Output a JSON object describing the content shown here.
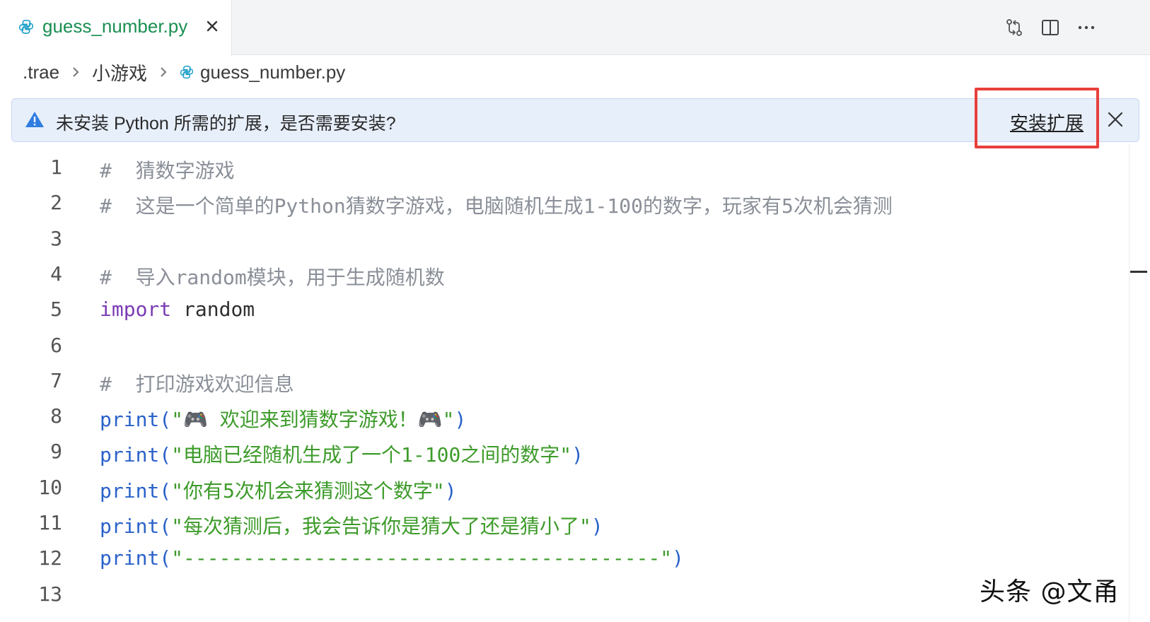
{
  "tab": {
    "title": "guess_number.py"
  },
  "breadcrumb": {
    "items": [
      ".trae",
      "小游戏",
      "guess_number.py"
    ]
  },
  "notification": {
    "message": "未安装 Python 所需的扩展，是否需要安装?",
    "action_label": "安装扩展"
  },
  "editor": {
    "lines": [
      {
        "num": "1",
        "parts": [
          {
            "t": "#  猜数字游戏",
            "k": "comment"
          }
        ]
      },
      {
        "num": "2",
        "parts": [
          {
            "t": "#  这是一个简单的Python猜数字游戏，电脑随机生成1-100的数字，玩家有5次机会猜测",
            "k": "comment"
          }
        ]
      },
      {
        "num": "3",
        "parts": []
      },
      {
        "num": "4",
        "parts": [
          {
            "t": "#  导入random模块，用于生成随机数",
            "k": "comment"
          }
        ]
      },
      {
        "num": "5",
        "parts": [
          {
            "t": "import",
            "k": "kw"
          },
          {
            "t": " random",
            "k": "plain"
          }
        ]
      },
      {
        "num": "6",
        "parts": []
      },
      {
        "num": "7",
        "parts": [
          {
            "t": "#  打印游戏欢迎信息",
            "k": "comment"
          }
        ]
      },
      {
        "num": "8",
        "parts": [
          {
            "t": "print(",
            "k": "fn"
          },
          {
            "t": "\"🎮 欢迎来到猜数字游戏！🎮\"",
            "k": "str"
          },
          {
            "t": ")",
            "k": "fn"
          }
        ]
      },
      {
        "num": "9",
        "parts": [
          {
            "t": "print(",
            "k": "fn"
          },
          {
            "t": "\"电脑已经随机生成了一个1-100之间的数字\"",
            "k": "str"
          },
          {
            "t": ")",
            "k": "fn"
          }
        ]
      },
      {
        "num": "10",
        "parts": [
          {
            "t": "print(",
            "k": "fn"
          },
          {
            "t": "\"你有5次机会来猜测这个数字\"",
            "k": "str"
          },
          {
            "t": ")",
            "k": "fn"
          }
        ]
      },
      {
        "num": "11",
        "parts": [
          {
            "t": "print(",
            "k": "fn"
          },
          {
            "t": "\"每次猜测后，我会告诉你是猜大了还是猜小了\"",
            "k": "str"
          },
          {
            "t": ")",
            "k": "fn"
          }
        ]
      },
      {
        "num": "12",
        "parts": [
          {
            "t": "print(",
            "k": "fn"
          },
          {
            "t": "\"----------------------------------------\"",
            "k": "str"
          },
          {
            "t": ")",
            "k": "fn"
          }
        ]
      },
      {
        "num": "13",
        "parts": []
      }
    ]
  },
  "watermark": "头条 @文甬",
  "icons": {
    "tab": "python-file-icon",
    "toolbar": [
      "compare-changes-icon",
      "split-editor-icon",
      "more-actions-icon"
    ],
    "warning": "warning-triangle-icon"
  },
  "colors": {
    "tab_title": "#1a8f52",
    "highlight_box": "#e8403c",
    "notification_bg": "#e7effb",
    "keyword": "#7a3bb4",
    "function": "#2a62c9",
    "string": "#3d9b2a",
    "comment": "#8a8f98"
  }
}
